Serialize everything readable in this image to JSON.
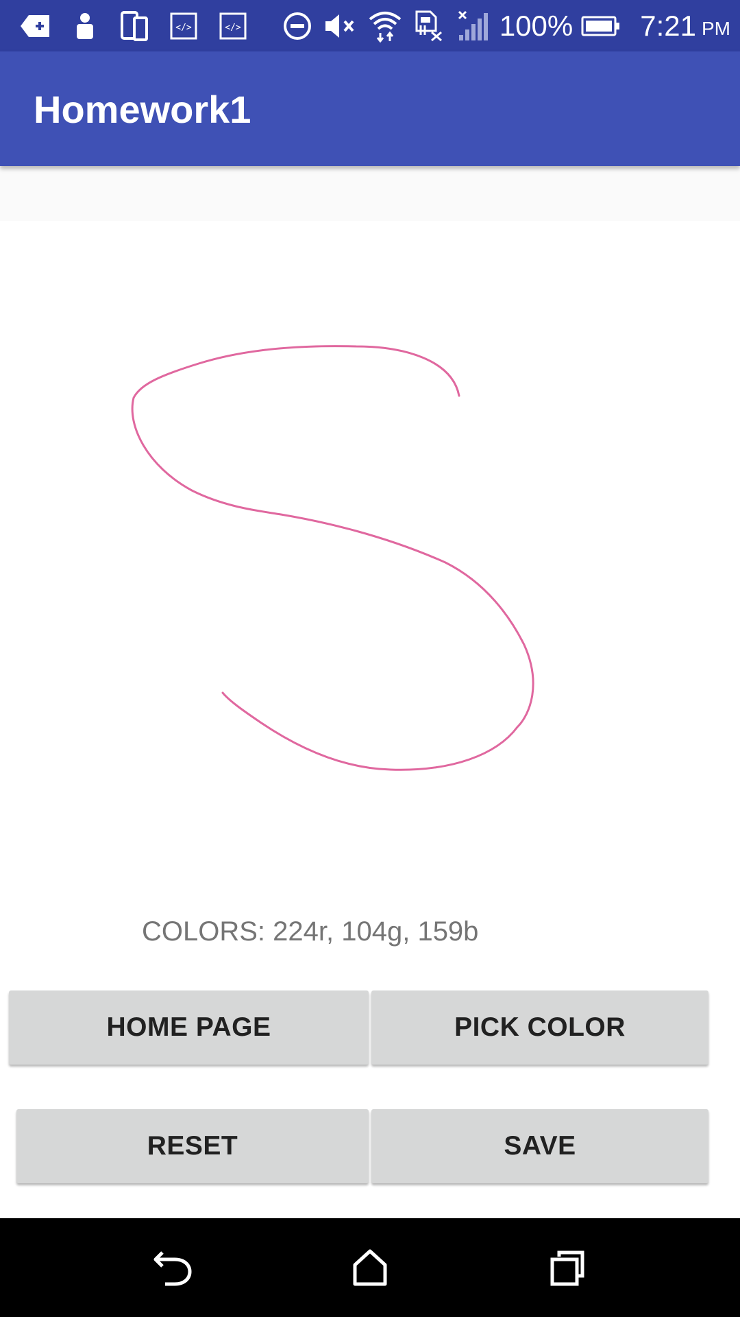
{
  "status_bar": {
    "icons_left": [
      "notification-back-icon",
      "person-icon",
      "devices-icon",
      "code-icon",
      "code-icon"
    ],
    "icons_right": [
      "do-not-disturb-icon",
      "volume-mute-icon",
      "wifi-icon",
      "no-sim-icon",
      "signal-icon"
    ],
    "battery_text": "100%",
    "battery_icon": "battery-full-icon",
    "time": "7:21",
    "ampm": "PM"
  },
  "app_bar": {
    "title": "Homework1"
  },
  "drawing": {
    "stroke_color": "#E0689F"
  },
  "colors_label": "COLORS: 224r, 104g, 159b",
  "buttons": {
    "home_page": "HOME PAGE",
    "pick_color": "PICK COLOR",
    "reset": "RESET",
    "save": "SAVE"
  },
  "nav_bar": {
    "back_icon": "back-icon",
    "home_icon": "home-icon",
    "recents_icon": "recents-icon"
  },
  "theme": {
    "primary": "#3F51B5",
    "primary_dark": "#303F9F",
    "button_bg": "#D6D7D7"
  }
}
